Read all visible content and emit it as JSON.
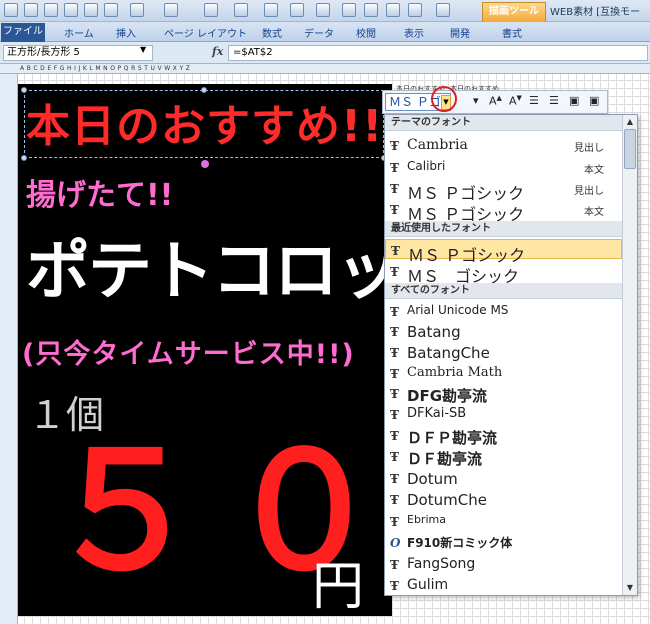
{
  "titlebar": {
    "context_tab": "描画ツール",
    "window_title": "WEB素材 [互換モー"
  },
  "ribbon": {
    "tabs": [
      "ファイル",
      "ホーム",
      "挿入",
      "ページ レイアウト",
      "数式",
      "データ",
      "校閲",
      "表示",
      "開発",
      "書式"
    ]
  },
  "formula_bar": {
    "name_box": "正方形/長方形 5",
    "fx": "fx",
    "formula": "=$AT$2"
  },
  "poster": {
    "title": "本日のおすすめ!!",
    "sub1": "揚げたて!!",
    "product": "ポテトコロッケ",
    "sub2": "(只今タイムサービス中!!)",
    "qty": "１個",
    "price": "５０",
    "unit": "円"
  },
  "mini_toolbar": {
    "font_value": "ＭＳ Ｐゴ",
    "label_left": "本日のおすすめ",
    "label_right": "本日のおすすめ"
  },
  "font_dropdown": {
    "theme_header": "テーマのフォント",
    "theme_fonts": [
      {
        "name": "Cambria",
        "tag": "見出し"
      },
      {
        "name": "Calibri",
        "tag": "本文"
      },
      {
        "name": "ＭＳ Ｐゴシック",
        "tag": "見出し"
      },
      {
        "name": "ＭＳ Ｐゴシック",
        "tag": "本文"
      }
    ],
    "recent_header": "最近使用したフォント",
    "recent_fonts": [
      "ＭＳ Ｐゴシック",
      "ＭＳ　ゴシック"
    ],
    "all_header": "すべてのフォント",
    "all_fonts": [
      "Arial Unicode MS",
      "Batang",
      "BatangChe",
      "Cambria Math",
      "DFG勘亭流",
      "DFKai-SB",
      "ＤＦＰ勘亭流",
      "ＤＦ勘亭流",
      "Dotum",
      "DotumChe",
      "Ebrima",
      "F910新コミック体",
      "FangSong",
      "Gulim"
    ]
  },
  "colors": {
    "poster_bg": "#000000",
    "title_red": "#ff2a2a",
    "pink": "#ff6cd0",
    "selection": "#ffe6a2"
  }
}
